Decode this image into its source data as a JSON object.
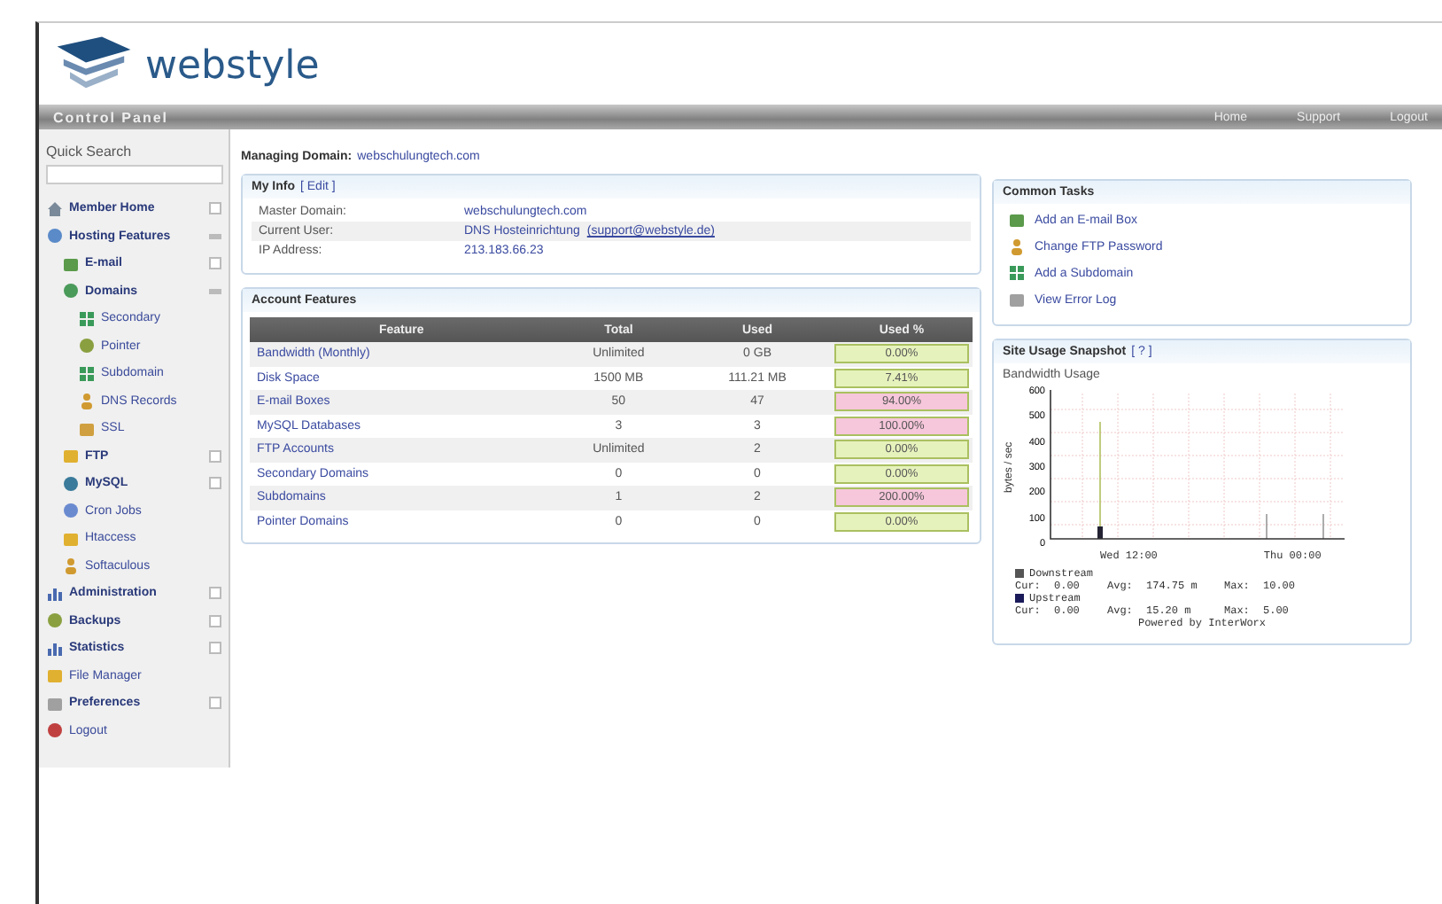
{
  "brand": "webstyle",
  "header": {
    "title": "Control Panel",
    "links": [
      "Home",
      "Support",
      "Logout"
    ]
  },
  "sidebar": {
    "title": "Quick Search",
    "items": [
      {
        "label": "Member Home",
        "expanded": false
      },
      {
        "label": "Hosting Features",
        "expanded": true,
        "children": [
          {
            "label": "E-mail",
            "expanded": false
          },
          {
            "label": "Domains",
            "expanded": true,
            "children": [
              {
                "label": "Secondary"
              },
              {
                "label": "Pointer"
              },
              {
                "label": "Subdomain"
              },
              {
                "label": "DNS Records"
              },
              {
                "label": "SSL"
              }
            ]
          },
          {
            "label": "FTP",
            "expanded": false
          },
          {
            "label": "MySQL",
            "expanded": false
          },
          {
            "label": "Cron Jobs"
          },
          {
            "label": "Htaccess"
          },
          {
            "label": "Softaculous"
          }
        ]
      },
      {
        "label": "Administration",
        "expanded": false
      },
      {
        "label": "Backups",
        "expanded": false
      },
      {
        "label": "Statistics",
        "expanded": false
      },
      {
        "label": "File Manager"
      },
      {
        "label": "Preferences",
        "expanded": false
      },
      {
        "label": "Logout"
      }
    ]
  },
  "managing": {
    "label": "Managing Domain:",
    "domain": "webschulungtech.com"
  },
  "my_info": {
    "title": "My Info",
    "edit": "[ Edit ]",
    "rows": [
      {
        "label": "Master Domain:",
        "value": "webschulungtech.com"
      },
      {
        "label": "Current User:",
        "value": "DNS Hosteinrichtung",
        "email": "(support@webstyle.de)"
      },
      {
        "label": "IP Address:",
        "value": "213.183.66.23"
      }
    ]
  },
  "account_features": {
    "title": "Account Features",
    "columns": [
      "Feature",
      "Total",
      "Used",
      "Used %"
    ],
    "rows": [
      {
        "feature": "Bandwidth (Monthly)",
        "total": "Unlimited",
        "used": "0 GB",
        "percent": "0.00%",
        "color": "#e6f2bc"
      },
      {
        "feature": "Disk Space",
        "total": "1500 MB",
        "used": "111.21 MB",
        "percent": "7.41%",
        "color": "#e6f2bc"
      },
      {
        "feature": "E-mail Boxes",
        "total": "50",
        "used": "47",
        "percent": "94.00%",
        "color": "#f6c6da"
      },
      {
        "feature": "MySQL Databases",
        "total": "3",
        "used": "3",
        "percent": "100.00%",
        "color": "#f6c6da"
      },
      {
        "feature": "FTP Accounts",
        "total": "Unlimited",
        "used": "2",
        "percent": "0.00%",
        "color": "#e6f2bc"
      },
      {
        "feature": "Secondary Domains",
        "total": "0",
        "used": "0",
        "percent": "0.00%",
        "color": "#e6f2bc"
      },
      {
        "feature": "Subdomains",
        "total": "1",
        "used": "2",
        "percent": "200.00%",
        "color": "#f6c6da"
      },
      {
        "feature": "Pointer Domains",
        "total": "0",
        "used": "0",
        "percent": "0.00%",
        "color": "#e6f2bc"
      }
    ]
  },
  "common_tasks": {
    "title": "Common Tasks",
    "items": [
      "Add an E-mail Box",
      "Change FTP Password",
      "Add a Subdomain",
      "View Error Log"
    ]
  },
  "site_usage": {
    "title": "Site Usage Snapshot",
    "help": "[ ? ]",
    "graph_title": "Bandwidth Usage",
    "ylabel": "bytes / sec",
    "yticks": [
      "600",
      "500",
      "400",
      "300",
      "200",
      "100",
      "0"
    ],
    "xticks": [
      "Wed 12:00",
      "Thu 00:00"
    ],
    "legend": [
      {
        "name": "Downstream",
        "color": "#555555",
        "cur": "Cur:",
        "cur_value": "0.00",
        "avg": "Avg:",
        "avg_value": "174.75 m",
        "max": "Max:",
        "max_value": "10.00"
      },
      {
        "name": "Upstream",
        "color": "#1a1a5a",
        "cur": "Cur:",
        "cur_value": "0.00",
        "avg": "Avg:",
        "avg_value": "15.20 m",
        "max": "Max:",
        "max_value": "5.00"
      }
    ],
    "powered": "Powered by InterWorx"
  }
}
